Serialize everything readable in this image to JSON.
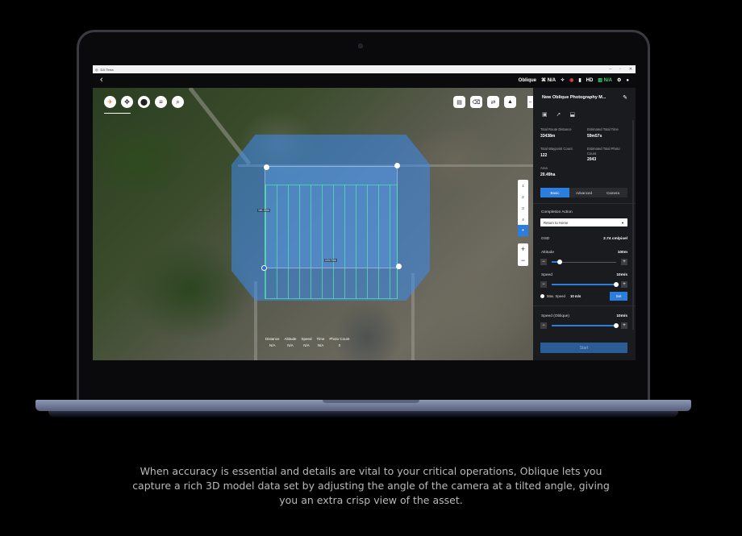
{
  "window": {
    "app_title": "DJI Terra"
  },
  "topbar": {
    "back_icon": "chevron-left-icon",
    "mode": "Oblique",
    "rtk": "N/A",
    "hd_label": "HD",
    "signal": "N/A"
  },
  "map": {
    "buttons": [
      "compass-icon",
      "move-icon",
      "pin-icon",
      "layers-icon",
      "search-icon"
    ],
    "right_buttons": [
      "clipboard-icon",
      "eraser-icon",
      "swap-icon",
      "north-icon"
    ],
    "steps": [
      "1",
      "2",
      "3",
      "4"
    ],
    "dim_labels": [
      "161.33m",
      "124.74m"
    ],
    "stats": {
      "headers": [
        "Distance",
        "Altitude",
        "Speed",
        "Time",
        "Photo Count"
      ],
      "values": [
        "N/A",
        "N/A",
        "N/A",
        "N/A",
        "0"
      ]
    }
  },
  "panel": {
    "title": "New Oblique Photography M...",
    "total_route_distance_label": "Total Route Distance",
    "total_route_distance": "33438m",
    "estimated_total_time_label": "Estimated Total Time",
    "estimated_total_time": "59m57s",
    "total_waypoint_count_label": "Total Waypoint Count",
    "total_waypoint_count": "122",
    "estimated_total_photo_count_label": "Estimated Total Photo Count",
    "estimated_total_photo_count": "2043",
    "area_label": "Area",
    "area": "20.49ha",
    "tabs": [
      "Basic",
      "Advanced",
      "Camera"
    ],
    "completion_action_label": "Completion Action",
    "completion_action_value": "Return to Home",
    "gsd_label": "GSD",
    "gsd_value": "2.74 cm/pixel",
    "altitude_label": "Altitude",
    "altitude_value": "100m",
    "altitude_level": 0.12,
    "speed_label": "Speed",
    "speed_value": "10m/s",
    "speed_level": 1.0,
    "max_speed_label": "Max. Speed",
    "max_speed_value": "10 m/s",
    "set_label": "Set",
    "speed_oblique_label": "Speed (Oblique)",
    "speed_oblique_value": "10m/s",
    "speed_oblique_level": 1.0,
    "start_label": "Start"
  },
  "caption": "When accuracy is essential and details are vital to your critical operations, Oblique lets you capture a rich 3D model data set by adjusting the angle of the camera at a tilted angle, giving you an extra crisp view of the asset."
}
